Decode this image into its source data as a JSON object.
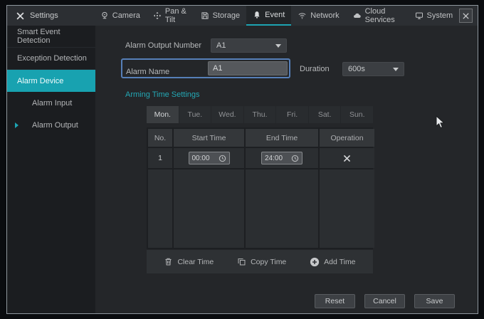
{
  "window": {
    "title": "Settings"
  },
  "topbar": {
    "tabs": [
      {
        "label": "Camera",
        "icon": "camera-icon"
      },
      {
        "label": "Pan & Tilt",
        "icon": "pan-tilt-icon"
      },
      {
        "label": "Storage",
        "icon": "storage-icon"
      },
      {
        "label": "Event",
        "icon": "bell-icon",
        "active": true
      },
      {
        "label": "Network",
        "icon": "wifi-icon"
      },
      {
        "label": "Cloud Services",
        "icon": "cloud-icon"
      },
      {
        "label": "System",
        "icon": "monitor-icon"
      }
    ]
  },
  "sidebar": {
    "items": [
      {
        "label": "Smart Event Detection"
      },
      {
        "label": "Exception Detection"
      },
      {
        "label": "Alarm Device",
        "active": true
      },
      {
        "label": "Alarm Input",
        "indent": 1
      },
      {
        "label": "Alarm Output",
        "indent": 1,
        "caret": true
      }
    ]
  },
  "form": {
    "alarm_output_number": {
      "label": "Alarm Output Number",
      "value": "A1"
    },
    "alarm_name": {
      "label": "Alarm Name",
      "value": "A1"
    },
    "duration": {
      "label": "Duration",
      "value": "600s"
    }
  },
  "arming": {
    "section_title": "Arming Time Settings",
    "day_tabs": [
      "Mon.",
      "Tue.",
      "Wed.",
      "Thu.",
      "Fri.",
      "Sat.",
      "Sun."
    ],
    "active_day": "Mon.",
    "table": {
      "headers": [
        "No.",
        "Start Time",
        "End Time",
        "Operation"
      ],
      "rows": [
        {
          "no": "1",
          "start_time": "00:00",
          "end_time": "24:00"
        }
      ]
    },
    "actions": [
      {
        "label": "Clear Time",
        "icon": "trash-icon"
      },
      {
        "label": "Copy Time",
        "icon": "copy-icon"
      },
      {
        "label": "Add Time",
        "icon": "add-circle-icon"
      }
    ]
  },
  "footer": {
    "reset_label": "Reset",
    "cancel_label": "Cancel",
    "save_label": "Save"
  },
  "colors": {
    "accent_teal": "#1da3b2",
    "selected_item_bg": "#18a2b0",
    "focus_blue": "#567fb8"
  }
}
